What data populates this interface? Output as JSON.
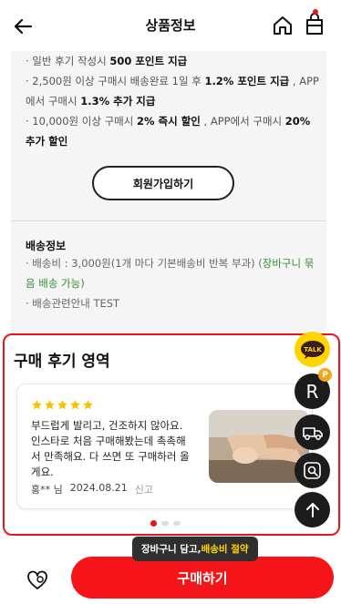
{
  "header": {
    "title": "상품정보"
  },
  "benefits": {
    "items": [
      {
        "pre": "· 일반 후기 작성시 ",
        "bold": "500 포인트 지급",
        "post": ""
      },
      {
        "pre": "· 2,500원 이상 구매시 배송완료 1일 후 ",
        "bold": "1.2% 포인트 지급",
        "post": " , APP에서 구매시 ",
        "bold2": "1.3% 추가 지급"
      },
      {
        "pre": "· 10,000원 이상 구매시 ",
        "bold": "2% 즉시 할인",
        "post": " , APP에서 구매시 ",
        "bold2": "20% 추가 할인"
      }
    ],
    "join_button": "회원가입하기"
  },
  "shipping": {
    "title": "배송정보",
    "fee_text": "· 배송비 : 3,000원(1개 마다 기본배송비 반복 부과) ",
    "fee_note": "(장바구니 묶음 배송 가능)",
    "guide_text": "· 배송관련안내 TEST"
  },
  "reviews": {
    "heading": "구매 후기 영역",
    "rating": 5,
    "text": "부드럽게 발리고, 건조하지 않아요. 인스타로 처음 구매해봤는데 촉촉해서 만족해요. 다 쓰면 또 구매하러 올게요.",
    "author": "홍** 님",
    "date": "2024.08.21",
    "report_label": "신고",
    "pager_count": 3,
    "pager_active": 0
  },
  "floating": {
    "talk_label": "TALK",
    "r_label": "R",
    "p_badge": "P"
  },
  "bottom": {
    "tooltip_prefix": "장바구니 담고, ",
    "tooltip_highlight": "배송비 절약",
    "buy_label": "구매하기"
  },
  "colors": {
    "brand_red": "#f5141a",
    "talk_yellow": "#ffd400",
    "star_yellow": "#f7c200",
    "note_green": "#3b8a3b",
    "fab_dark": "#1c1c1c"
  },
  "icons": [
    "back-arrow-icon",
    "home-icon",
    "shopping-bag-icon",
    "star-icon",
    "talk-icon",
    "delivery-truck-icon",
    "photo-search-icon",
    "arrow-up-icon",
    "heart-icon"
  ]
}
